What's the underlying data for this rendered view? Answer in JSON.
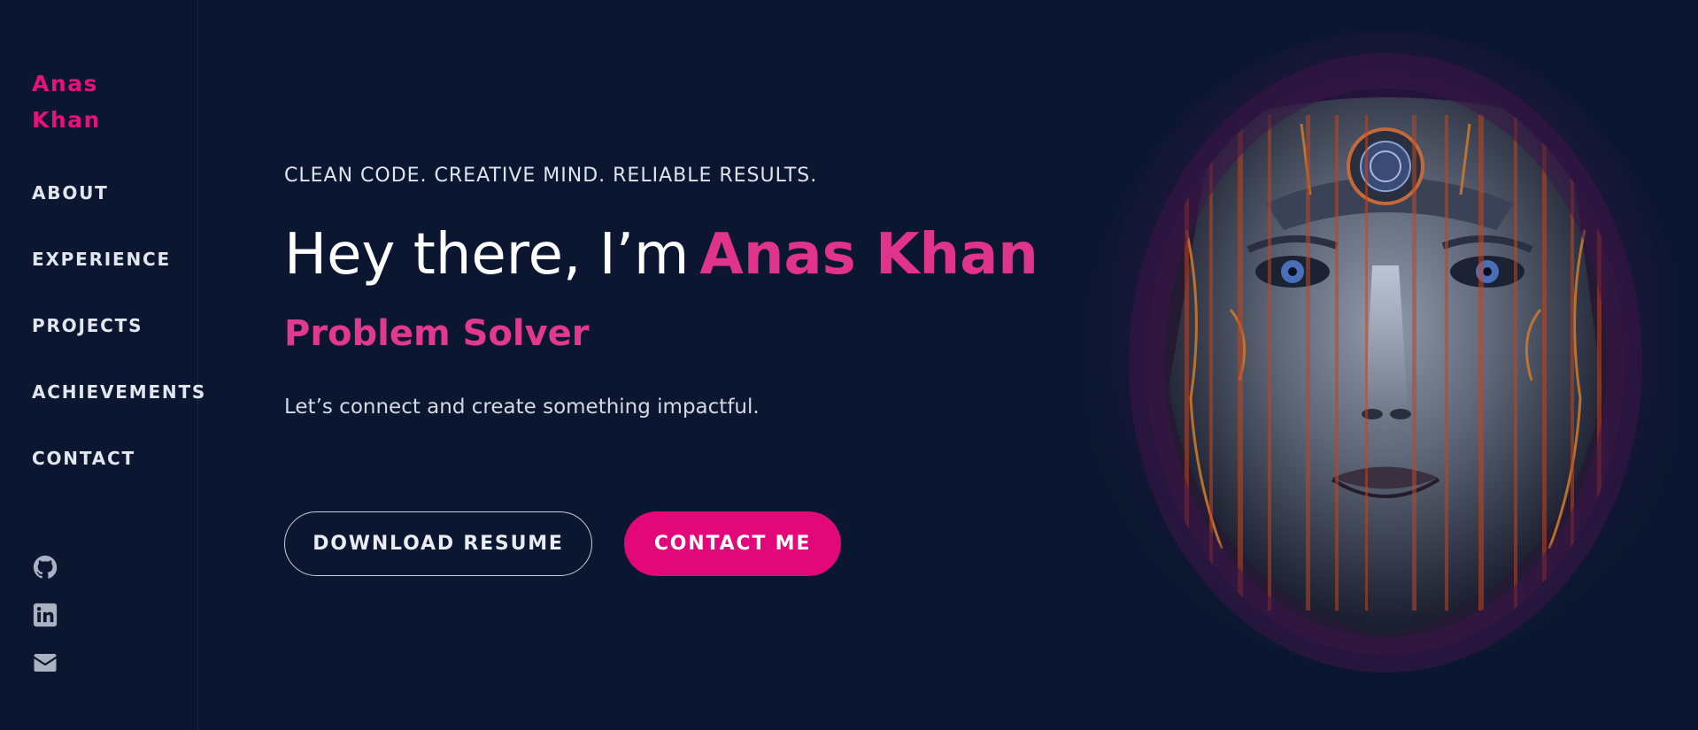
{
  "brand": {
    "line1": "Anas",
    "line2": "Khan"
  },
  "nav": {
    "items": [
      {
        "label": "ABOUT"
      },
      {
        "label": "EXPERIENCE"
      },
      {
        "label": "PROJECTS"
      },
      {
        "label": "ACHIEVEMENTS"
      },
      {
        "label": "CONTACT"
      }
    ]
  },
  "social": [
    {
      "icon": "github-icon"
    },
    {
      "icon": "linkedin-icon"
    },
    {
      "icon": "email-icon"
    }
  ],
  "hero": {
    "tagline": "CLEAN CODE. CREATIVE MIND. RELIABLE RESULTS.",
    "greeting": "Hey there, I’m",
    "name": "Anas Khan",
    "role": "Problem Solver",
    "description": "Let’s connect and create something impactful.",
    "download_label": "DOWNLOAD RESUME",
    "contact_label": "CONTACT ME",
    "image_icon": "cyborg-face-portrait"
  },
  "colors": {
    "background": "#0b1730",
    "accent": "#e2087a",
    "accent_text": "#e0338c",
    "text": "#e2e6ee"
  }
}
